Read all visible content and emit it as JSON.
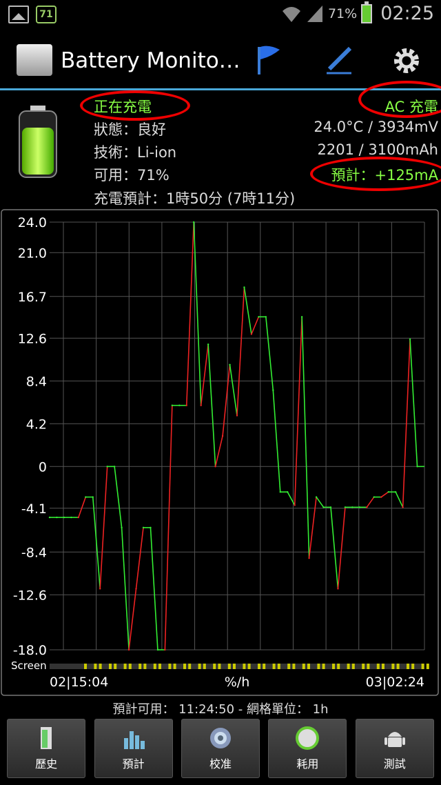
{
  "status_bar": {
    "notif_badge": "71",
    "battery_percent": "71%",
    "time": "02:25"
  },
  "action_bar": {
    "title": "Battery Monito…"
  },
  "info": {
    "charging_state": "正在充電",
    "source": "AC 充電",
    "status": "狀態：良好",
    "temp_voltage": "24.0°C / 3934mV",
    "tech": "技術：Li-ion",
    "capacity": "2201 / 3100mAh",
    "available": "可用：71%",
    "estimate_current": "預計：+125mA",
    "charge_estimate": "充電預計：1時50分 (7時11分)"
  },
  "chart_data": {
    "type": "line",
    "title": "",
    "xlabel": "%/h",
    "ylabel": "",
    "ylim": [
      -18.0,
      24.0
    ],
    "y_ticks": [
      "24.0",
      "21.0",
      "16.7",
      "12.6",
      "8.4",
      "4.2",
      "0",
      "-4.1",
      "-8.4",
      "-12.6",
      "-18.0"
    ],
    "x_start_label": "02|15:04",
    "x_end_label": "03|02:24",
    "screen_label": "Screen",
    "series": [
      {
        "values": [
          -5,
          -5,
          -5,
          -5,
          -5,
          -3,
          -3,
          -12,
          0,
          0,
          -6,
          -18,
          -12,
          -6,
          -6,
          -18,
          -18,
          6,
          6,
          6,
          24,
          6,
          12,
          0,
          3,
          10,
          5,
          17.6,
          13,
          14.7,
          14.7,
          7.5,
          -2.5,
          -2.5,
          -3.8,
          14.7,
          -9,
          -3,
          -4,
          -4,
          -12,
          -4,
          -4,
          -4,
          -4,
          -3,
          -3,
          -2.5,
          -2.5,
          -4,
          12.5,
          0,
          0
        ]
      }
    ],
    "colors": {
      "rising": "#e22",
      "falling": "#3e3",
      "grid": "#555",
      "screen_on": "#cc0"
    }
  },
  "footer": {
    "estimate": "預計可用： 11:24:50 - 網格單位： 1h"
  },
  "buttons": [
    {
      "label": "歷史",
      "icon": "history-icon"
    },
    {
      "label": "預計",
      "icon": "estimate-icon"
    },
    {
      "label": "校准",
      "icon": "calibrate-icon"
    },
    {
      "label": "耗用",
      "icon": "usage-icon"
    },
    {
      "label": "測試",
      "icon": "android-test-icon"
    }
  ]
}
